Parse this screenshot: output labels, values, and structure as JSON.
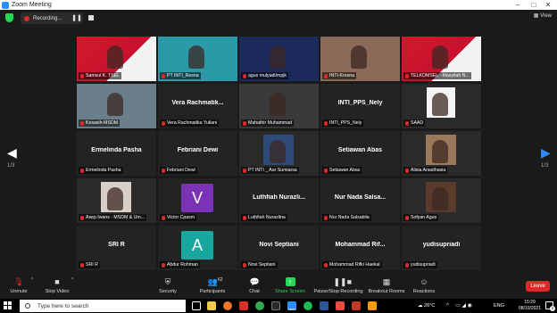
{
  "window": {
    "title": "Zoom Meeting"
  },
  "topbar": {
    "recording_label": "Recording...",
    "view_label": "View"
  },
  "pagination": {
    "left": "1/3",
    "right": "1/3"
  },
  "tiles": [
    {
      "name": "Samsul K. TSEL",
      "display": "",
      "type": "video",
      "bg": "#c8102e"
    },
    {
      "name": "PT INTI_Resna",
      "display": "",
      "type": "video",
      "bg": "#2a9aa8"
    },
    {
      "name": "agus mulyadi/mpjk",
      "display": "",
      "type": "video",
      "bg": "#1b2a5a"
    },
    {
      "name": "INTI-Kresna",
      "display": "",
      "type": "video",
      "bg": "#8c6a5a"
    },
    {
      "name": "TELKOMSEL - Masyitah N...",
      "display": "",
      "type": "video",
      "bg": "#c8102e"
    },
    {
      "name": "Kosasih-MSDM",
      "display": "",
      "type": "video",
      "bg": "#6b7f8a"
    },
    {
      "name": "Vera Rachmatika Yuliani",
      "display": "Vera Rachmatik...",
      "type": "text"
    },
    {
      "name": "Mahathir Muhammad",
      "display": "",
      "type": "video",
      "bg": "#3a3a3a"
    },
    {
      "name": "INTI_PPS_Nely",
      "display": "INTI_PPS_Nely",
      "type": "text"
    },
    {
      "name": "SAAD",
      "display": "",
      "type": "photo",
      "bg": "#ffffff"
    },
    {
      "name": "Ermelinda Pasha",
      "display": "Ermelinda Pasha",
      "type": "text"
    },
    {
      "name": "Febriani Dewi",
      "display": "Febriani Dewi",
      "type": "text"
    },
    {
      "name": "PT INTI _ Aar Sumiarsa",
      "display": "",
      "type": "photo",
      "bg": "#2e4a78"
    },
    {
      "name": "Setiawan Abas",
      "display": "Setiawan Abas",
      "type": "text"
    },
    {
      "name": "Alisia Anasthasia",
      "display": "",
      "type": "photo",
      "bg": "#9a7a5a"
    },
    {
      "name": "Asep Iwans - MSDM & Um...",
      "display": "",
      "type": "photo",
      "bg": "#d8d0c8"
    },
    {
      "name": "Victor Cpasm",
      "display": "V",
      "type": "avatar",
      "bg": "#7b33b5"
    },
    {
      "name": "Luthfiah Nurazlina",
      "display": "Luthfiah Nurazli...",
      "type": "text"
    },
    {
      "name": "Nur Nada Salsabila",
      "display": "Nur Nada Salsa...",
      "type": "text"
    },
    {
      "name": "Sofyan Agus",
      "display": "",
      "type": "photo",
      "bg": "#5a3a2a"
    },
    {
      "name": "SRI R",
      "display": "SRI R",
      "type": "text"
    },
    {
      "name": "Abdur Rohman",
      "display": "A",
      "type": "avatar",
      "bg": "#16a8a0"
    },
    {
      "name": "Novi Septiani",
      "display": "Novi Septiani",
      "type": "text"
    },
    {
      "name": "Mohammad Rifki Haekal",
      "display": "Mohammad Rif...",
      "type": "text"
    },
    {
      "name": "yudisupriadi",
      "display": "yudisupriadi",
      "type": "text"
    }
  ],
  "controls": {
    "unmute": "Unmute",
    "stop_video": "Stop Video",
    "security": "Security",
    "participants": "Participants",
    "participants_count": "62",
    "chat": "Chat",
    "share_screen": "Share Screen",
    "record": "Pause/Stop Recording",
    "breakout": "Breakout Rooms",
    "reactions": "Reactions",
    "leave": "Leave"
  },
  "taskbar": {
    "search_placeholder": "Type here to search",
    "weather": "26°C",
    "lang": "ENG",
    "time": "15:29",
    "date": "08/10/2021",
    "notifications": "2"
  },
  "colors": {
    "accent": "#2d8cff",
    "share_green": "#23d959",
    "leave_red": "#e02828",
    "active_border": "#f4d23a"
  }
}
